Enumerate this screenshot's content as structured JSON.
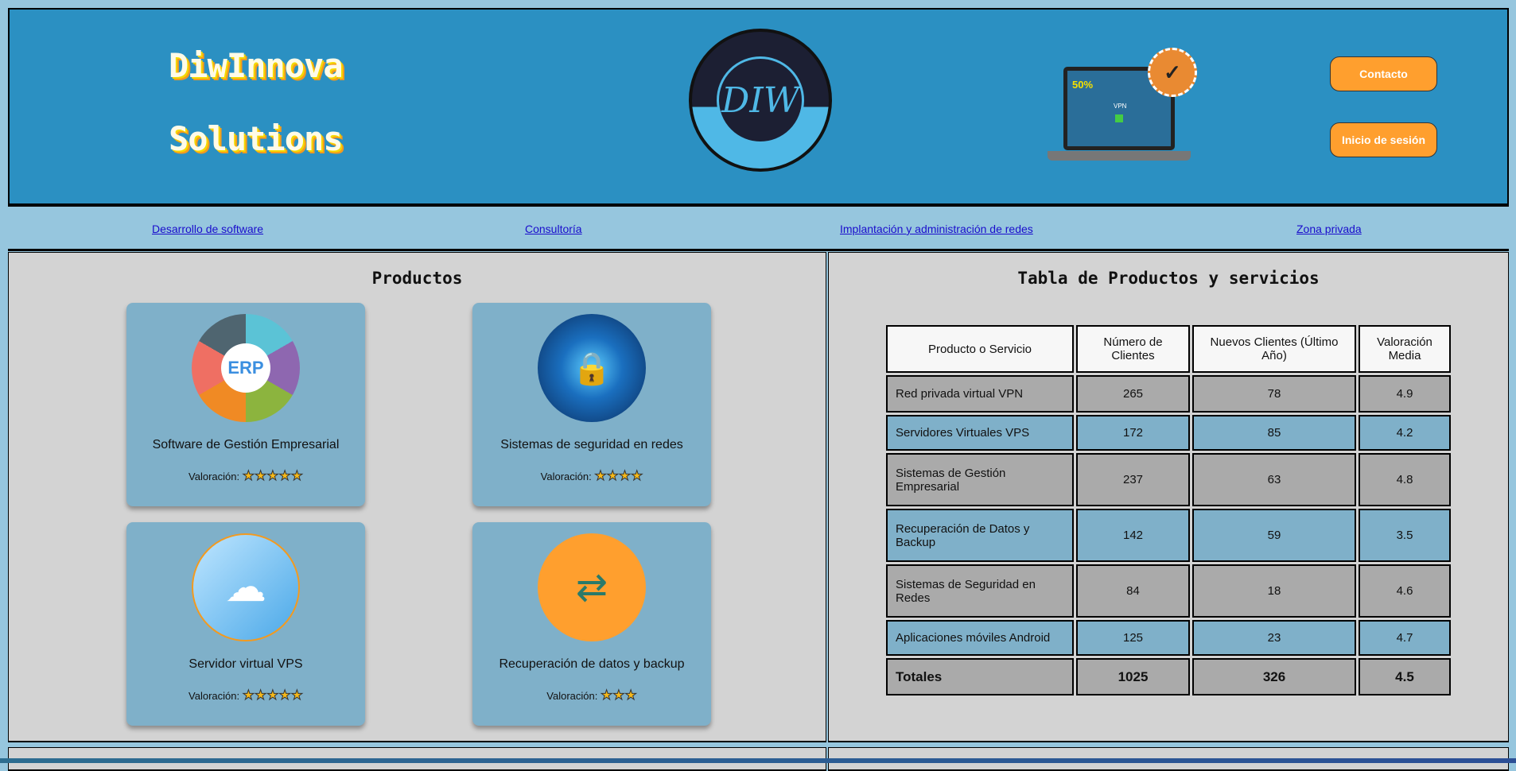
{
  "header": {
    "brand_line1": "DiwInnova",
    "brand_line2": "Solutions",
    "logo_text": "DIW",
    "promo_badge": "50%",
    "vpn_label": "VPN",
    "buttons": {
      "contact": "Contacto",
      "login": "Inicio de sesión"
    }
  },
  "nav": {
    "links": [
      "Desarrollo de software",
      "Consultoría",
      "Implantación y administración de redes",
      "Zona privada"
    ]
  },
  "products": {
    "title": "Productos",
    "rating_label": "Valoración:",
    "items": [
      {
        "name": "Software de Gestión Empresarial",
        "stars": 5
      },
      {
        "name": "Sistemas de seguridad en redes",
        "stars": 4
      },
      {
        "name": "Servidor virtual VPS",
        "stars": 5
      },
      {
        "name": "Recuperación de datos y backup",
        "stars": 3
      }
    ]
  },
  "table": {
    "title": "Tabla de Productos y servicios",
    "headers": [
      "Producto o Servicio",
      "Número de Clientes",
      "Nuevos Clientes (Último Año)",
      "Valoración Media"
    ],
    "rows": [
      [
        "Red privada virtual VPN",
        "265",
        "78",
        "4.9"
      ],
      [
        "Servidores Virtuales VPS",
        "172",
        "85",
        "4.2"
      ],
      [
        "Sistemas de Gestión Empresarial",
        "237",
        "63",
        "4.8"
      ],
      [
        "Recuperación de Datos y Backup",
        "142",
        "59",
        "3.5"
      ],
      [
        "Sistemas de Seguridad en Redes",
        "84",
        "18",
        "4.6"
      ],
      [
        "Aplicaciones móviles Android",
        "125",
        "23",
        "4.7"
      ]
    ],
    "totals": [
      "Totales",
      "1025",
      "326",
      "4.5"
    ]
  },
  "colors": {
    "header": "#2b90c2",
    "accent": "#ff9f2e",
    "card": "#7fb0c9"
  }
}
